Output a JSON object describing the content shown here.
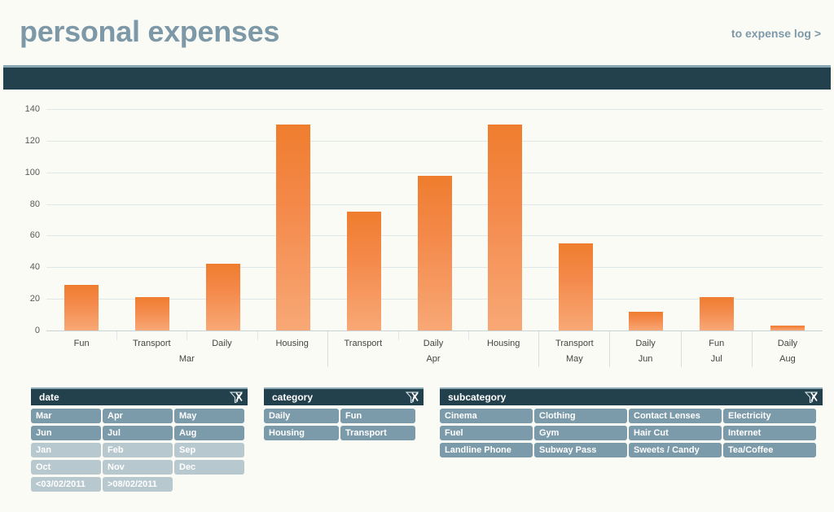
{
  "header": {
    "title": "personal expenses",
    "link_label": "to expense log >",
    "title_color": "#7d99a8",
    "navbar_color": "#23404d"
  },
  "chart_data": {
    "type": "bar",
    "title": "personal expenses",
    "xlabel": "",
    "ylabel": "",
    "ylim": [
      0,
      140
    ],
    "yticks": [
      140,
      120,
      100,
      80,
      60,
      40,
      20,
      0
    ],
    "grid": true,
    "legend": "none",
    "bar_color_top": "#ef7d2e",
    "bar_color_bottom": "#f8a876",
    "groups": [
      {
        "label": "Mar",
        "categories": [
          "Fun",
          "Transport",
          "Daily",
          "Housing"
        ],
        "values": [
          29,
          21,
          42,
          130
        ]
      },
      {
        "label": "Apr",
        "categories": [
          "Transport",
          "Daily",
          "Housing"
        ],
        "values": [
          75,
          98,
          130
        ]
      },
      {
        "label": "May",
        "categories": [
          "Transport"
        ],
        "values": [
          55
        ]
      },
      {
        "label": "Jun",
        "categories": [
          "Daily"
        ],
        "values": [
          12
        ]
      },
      {
        "label": "Jul",
        "categories": [
          "Fun"
        ],
        "values": [
          21
        ]
      },
      {
        "label": "Aug",
        "categories": [
          "Daily"
        ],
        "values": [
          3
        ]
      }
    ],
    "categories": [
      "Fun",
      "Transport",
      "Daily",
      "Housing",
      "Transport",
      "Daily",
      "Housing",
      "Transport",
      "Daily",
      "Fun",
      "Daily"
    ],
    "values": [
      29,
      21,
      42,
      130,
      75,
      98,
      130,
      55,
      12,
      21,
      3
    ]
  },
  "filters": [
    {
      "id": "date",
      "title": "date",
      "clear_icon": "clear-filter-icon",
      "chips": [
        {
          "label": "Mar",
          "selected": true
        },
        {
          "label": "Apr",
          "selected": true
        },
        {
          "label": "May",
          "selected": true
        },
        {
          "label": "Jun",
          "selected": true
        },
        {
          "label": "Jul",
          "selected": true
        },
        {
          "label": "Aug",
          "selected": true
        },
        {
          "label": "Jan",
          "selected": false
        },
        {
          "label": "Feb",
          "selected": false
        },
        {
          "label": "Sep",
          "selected": false
        },
        {
          "label": "Oct",
          "selected": false
        },
        {
          "label": "Nov",
          "selected": false
        },
        {
          "label": "Dec",
          "selected": false
        },
        {
          "label": "<03/02/2011",
          "selected": false
        },
        {
          "label": ">08/02/2011",
          "selected": false
        }
      ]
    },
    {
      "id": "category",
      "title": "category",
      "clear_icon": "clear-filter-icon",
      "chips": [
        {
          "label": "Daily",
          "selected": true
        },
        {
          "label": "Fun",
          "selected": true
        },
        {
          "label": "Housing",
          "selected": true
        },
        {
          "label": "Transport",
          "selected": true
        }
      ]
    },
    {
      "id": "subcategory",
      "title": "subcategory",
      "clear_icon": "clear-filter-icon",
      "chips": [
        {
          "label": "Cinema",
          "selected": true
        },
        {
          "label": "Clothing",
          "selected": true
        },
        {
          "label": "Contact Lenses",
          "selected": true
        },
        {
          "label": "Electricity",
          "selected": true
        },
        {
          "label": "Fuel",
          "selected": true
        },
        {
          "label": "Gym",
          "selected": true
        },
        {
          "label": "Hair Cut",
          "selected": true
        },
        {
          "label": "Internet",
          "selected": true
        },
        {
          "label": "Landline Phone",
          "selected": true
        },
        {
          "label": "Subway Pass",
          "selected": true
        },
        {
          "label": "Sweets / Candy",
          "selected": true
        },
        {
          "label": "Tea/Coffee",
          "selected": true
        }
      ]
    }
  ]
}
